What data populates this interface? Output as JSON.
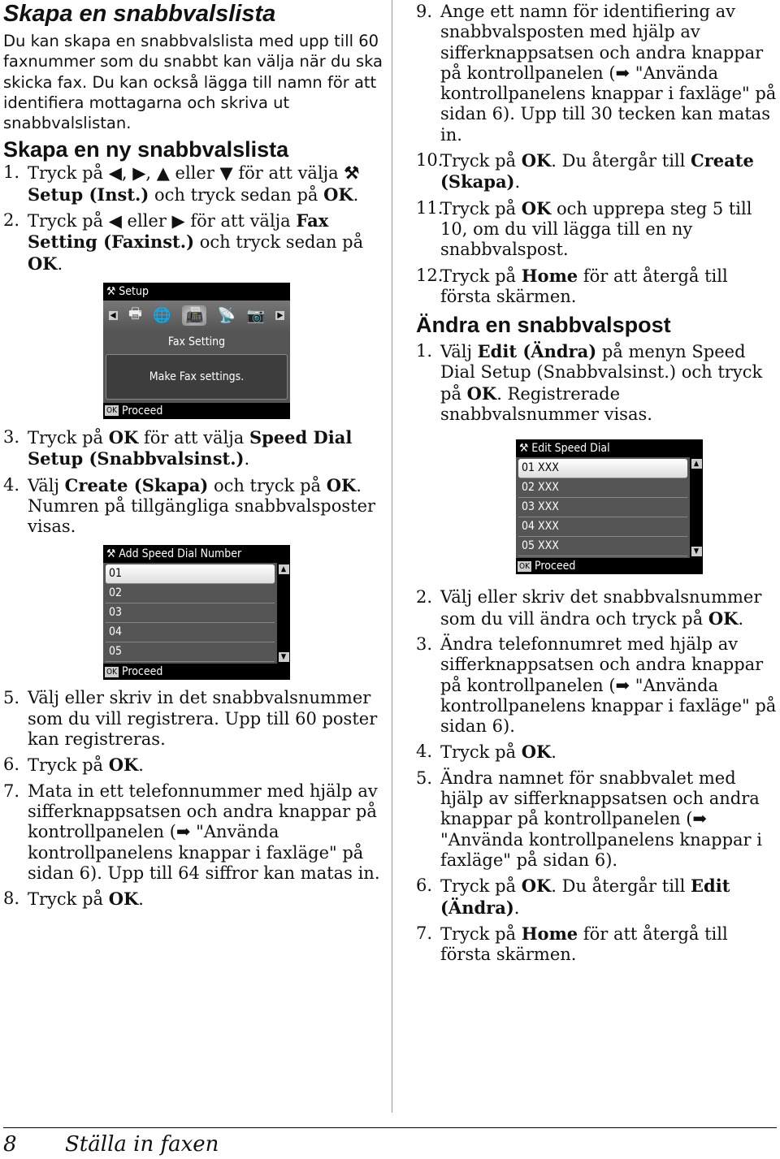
{
  "left": {
    "title": "Skapa en snabbvalslista",
    "intro": "Du kan skapa en snabbvalslista med upp till 60 faxnummer som du snabbt kan välja när du ska skicka fax. Du kan också lägga till namn för att identifiera mottagarna och skriva ut snabbvalslistan.",
    "subtitle": "Skapa en ny snabbvalslista",
    "steps": [
      {
        "num": "1.",
        "pre": "Tryck på ◀, ▶, ▲ eller ▼ för att välja ",
        "bold": "⚒ Setup (Inst.)",
        "post": " och tryck sedan på ",
        "bold2": "OK",
        "end": "."
      },
      {
        "num": "2.",
        "pre": "Tryck på ◀ eller ▶ för att välja ",
        "bold": "Fax Setting (Faxinst.)",
        "post": " och tryck sedan på ",
        "bold2": "OK",
        "end": "."
      },
      {
        "num": "3.",
        "pre": "Tryck på ",
        "bold": "OK",
        "post": " för att välja ",
        "bold2": "Speed Dial Setup (Snabbvalsinst.)",
        "end": "."
      },
      {
        "num": "4.",
        "pre": "Välj ",
        "bold": "Create (Skapa)",
        "post": " och tryck på ",
        "bold2": "OK",
        "end": ". Numren på tillgängliga snabbvalsposter visas."
      },
      {
        "num": "5.",
        "pre": "Välj eller skriv in det snabbvalsnummer som du vill registrera. Upp till 60 poster kan registreras.",
        "bold": "",
        "post": "",
        "bold2": "",
        "end": ""
      },
      {
        "num": "6.",
        "pre": "Tryck på ",
        "bold": "OK",
        "post": "",
        "bold2": "",
        "end": "."
      },
      {
        "num": "7.",
        "pre": "Mata in ett telefonnummer med hjälp av sifferknappsatsen och andra knappar på kontrollpanelen (➡ \"Använda kontrollpanelens knappar i faxläge\" på sidan 6). Upp till 64 siffror kan matas in.",
        "bold": "",
        "post": "",
        "bold2": "",
        "end": ""
      },
      {
        "num": "8.",
        "pre": "Tryck på ",
        "bold": "OK",
        "post": "",
        "bold2": "",
        "end": "."
      }
    ],
    "lcd_setup": {
      "title": "Setup",
      "icons": [
        "◀",
        "🖶",
        "🌐",
        "📠",
        "📡",
        "📷",
        "▶"
      ],
      "subtitle": "Fax Setting",
      "message": "Make Fax settings.",
      "ok": "OK",
      "footer": "Proceed"
    },
    "lcd_add": {
      "title": "Add Speed Dial Number",
      "items": [
        "01",
        "02",
        "03",
        "04",
        "05"
      ],
      "ok": "OK",
      "footer": "Proceed"
    }
  },
  "right": {
    "steps": [
      {
        "num": "9.",
        "pre": "Ange ett namn för identifiering av snabbvalsposten med hjälp av sifferknappsatsen och andra knappar på kontrollpanelen (➡ \"Använda kontrollpanelens knappar i faxläge\" på sidan 6). Upp till 30 tecken kan matas in.",
        "bold": "",
        "post": "",
        "bold2": "",
        "end": ""
      },
      {
        "num": "10.",
        "pre": "Tryck på ",
        "bold": "OK",
        "post": ". Du återgår till ",
        "bold2": "Create (Skapa)",
        "end": "."
      },
      {
        "num": "11.",
        "pre": "Tryck på ",
        "bold": "OK",
        "post": " och upprepa steg 5 till 10, om du vill lägga till en ny snabbvalspost.",
        "bold2": "",
        "end": ""
      },
      {
        "num": "12.",
        "pre": "Tryck på ",
        "bold": "Home",
        "post": " för att återgå till första skärmen.",
        "bold2": "",
        "end": ""
      }
    ],
    "subtitle": "Ändra en snabbvalspost",
    "steps2": [
      {
        "num": "1.",
        "pre": "Välj ",
        "bold": "Edit (Ändra)",
        "post": " på menyn Speed Dial Setup (Snabbvalsinst.) och tryck på ",
        "bold2": "OK",
        "end": ". Registrerade snabbvalsnummer visas."
      },
      {
        "num": "2.",
        "pre": "Välj eller skriv det snabbvalsnummer som du vill ändra och tryck på ",
        "bold": "OK",
        "post": "",
        "bold2": "",
        "end": "."
      },
      {
        "num": "3.",
        "pre": "Ändra telefonnumret med hjälp av sifferknappsatsen och andra knappar på kontrollpanelen (➡ \"Använda kontrollpanelens knappar i faxläge\" på sidan 6).",
        "bold": "",
        "post": "",
        "bold2": "",
        "end": ""
      },
      {
        "num": "4.",
        "pre": "Tryck på ",
        "bold": "OK",
        "post": "",
        "bold2": "",
        "end": "."
      },
      {
        "num": "5.",
        "pre": "Ändra namnet för snabbvalet med hjälp av sifferknappsatsen och andra knappar på kontrollpanelen (➡ \"Använda kontrollpanelens knappar i faxläge\" på sidan 6).",
        "bold": "",
        "post": "",
        "bold2": "",
        "end": ""
      },
      {
        "num": "6.",
        "pre": "Tryck på ",
        "bold": "OK",
        "post": ". Du återgår till ",
        "bold2": "Edit (Ändra)",
        "end": "."
      },
      {
        "num": "7.",
        "pre": "Tryck på ",
        "bold": "Home",
        "post": " för att återgå till första skärmen.",
        "bold2": "",
        "end": ""
      }
    ],
    "lcd_edit": {
      "title": "Edit Speed Dial",
      "items": [
        "01 XXX",
        "02 XXX",
        "03 XXX",
        "04 XXX",
        "05 XXX"
      ],
      "ok": "OK",
      "footer": "Proceed"
    }
  },
  "footer": {
    "page_number": "8",
    "section": "Ställa in faxen"
  }
}
